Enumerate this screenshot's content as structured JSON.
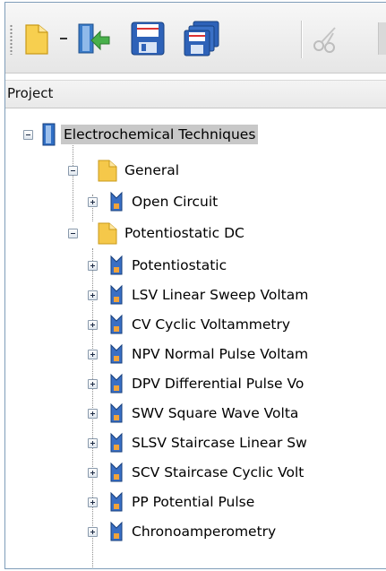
{
  "toolbar": {
    "buttons": [
      {
        "name": "new-folder-icon"
      },
      {
        "name": "dropdown-arrow-icon"
      },
      {
        "name": "import-icon"
      },
      {
        "name": "save-icon"
      },
      {
        "name": "save-all-icon"
      },
      {
        "name": "cut-icon"
      }
    ]
  },
  "panel": {
    "title": "Project"
  },
  "tree": {
    "root": "Electrochemical Techniques",
    "groups": [
      {
        "label": "General",
        "items": [
          "Open Circuit"
        ]
      },
      {
        "label": "Potentiostatic DC",
        "items": [
          "Potentiostatic",
          "LSV Linear Sweep Voltam",
          "CV Cyclic Voltammetry",
          "NPV Normal Pulse Voltam",
          "DPV Differential Pulse Vo",
          "SWV Square Wave Volta",
          "SLSV Staircase Linear Sw",
          "SCV Staircase Cyclic Volt",
          "PP Potential Pulse",
          "Chronoamperometry"
        ]
      }
    ]
  },
  "colors": {
    "selection": "#c8c8c8",
    "folder": "#f5c84a",
    "accent": "#3a6fc4"
  }
}
